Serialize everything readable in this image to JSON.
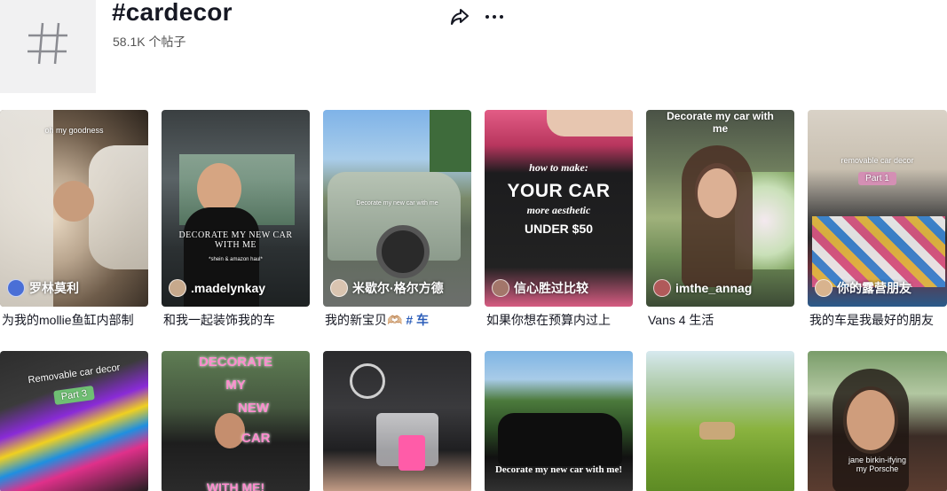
{
  "header": {
    "title": "#cardecor",
    "count": "58.1K 个帖子"
  },
  "row1": [
    {
      "overlay": "oh my goodness",
      "author": "罗林莫利",
      "caption_a": "为我的mollie鱼缸内部制",
      "caption_b": ""
    },
    {
      "overlay": "DECORATE MY NEW CAR WITH ME",
      "overlay2": "*shein & amazon haul*",
      "author": ".madelynkay",
      "caption_a": "和我一起装饰我的车",
      "caption_b": ""
    },
    {
      "overlay": "Decorate my new car with me",
      "author": "米歇尔·格尔方德",
      "caption_a": "我的新宝贝🫶🏼 ",
      "caption_b": "# 车"
    },
    {
      "overlay": "how to make:",
      "overlay2": "YOUR CAR",
      "overlay3": "more aesthetic",
      "overlay4": "UNDER $50",
      "author": "信心胜过比较",
      "caption_a": "如果你想在预算内过上",
      "caption_b": ""
    },
    {
      "overlay": "Decorate my car with me",
      "author": "imthe_annag",
      "caption_a": "Vans 4 生活",
      "caption_b": ""
    },
    {
      "overlay": "removable car decor",
      "overlay2": "Part 1",
      "author": "你的露营朋友",
      "caption_a": "我的车是我最好的朋友",
      "caption_b": ""
    }
  ],
  "row2": [
    {
      "overlay": "Removable car decor",
      "overlay2": "Part 3"
    },
    {
      "overlay": "DECORATE",
      "overlay2": "MY",
      "overlay3": "NEW",
      "overlay4": "CAR",
      "overlay5": "WITH ME!"
    },
    {
      "overlay": ""
    },
    {
      "overlay": "Decorate my new car with me!"
    },
    {
      "overlay": ""
    },
    {
      "overlay": "jane birkin-ifying my Porsche"
    }
  ],
  "icons": {
    "share": "share-icon",
    "more": "more-icon",
    "hashtag": "hashtag-icon"
  },
  "colors": {
    "accent": "#2b5db9",
    "text": "#161823"
  }
}
